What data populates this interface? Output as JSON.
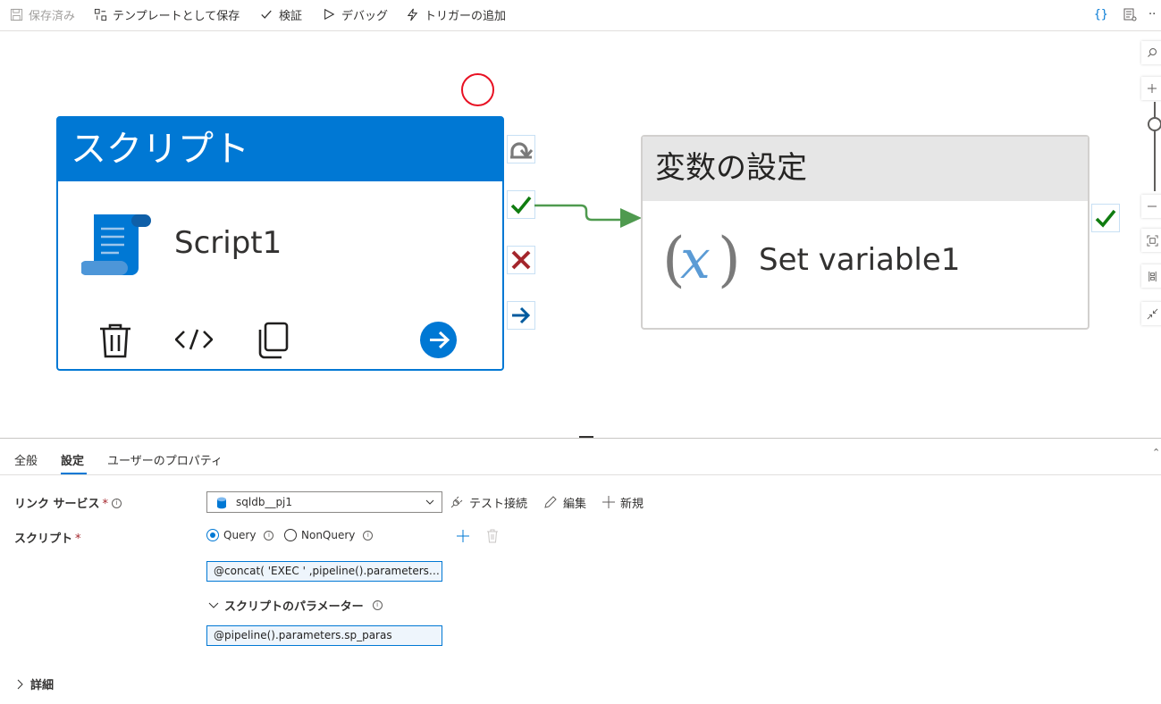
{
  "toolbar": {
    "saved": "保存済み",
    "save_as_template": "テンプレートとして保存",
    "validate": "検証",
    "debug": "デバッグ",
    "add_trigger": "トリガーの追加",
    "more": "··"
  },
  "canvas": {
    "script_activity": {
      "type_label": "スクリプト",
      "name": "Script1"
    },
    "setvar_activity": {
      "type_label": "変数の設定",
      "name": "Set variable1"
    }
  },
  "tabs": [
    "全般",
    "設定",
    "ユーザーのプロパティ"
  ],
  "active_tab": "設定",
  "settings": {
    "linked_service_label": "リンク サービス",
    "linked_service_value": "sqldb__pj1",
    "test_connection": "テスト接続",
    "edit": "編集",
    "new": "新規",
    "script_label": "スクリプト",
    "radio_query": "Query",
    "radio_nonquery": "NonQuery",
    "selected_radio": "Query",
    "script_text": "@concat( 'EXEC ' ,pipeline().parameters.sp_name)",
    "script_params_label": "スクリプトのパラメーター",
    "param_text": "@pipeline().parameters.sp_paras",
    "advanced_label": "詳細"
  },
  "colors": {
    "accent": "#0078d4",
    "success": "#107c10",
    "fail": "#a4262c",
    "connector": "#4f9a4f",
    "annotation": "#e81123"
  }
}
